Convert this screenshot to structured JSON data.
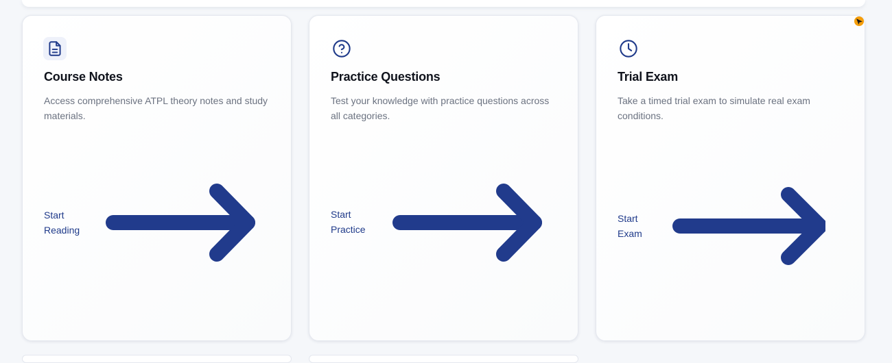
{
  "cards": [
    {
      "title": "Course Notes",
      "description": "Access comprehensive ATPL theory notes and study materials.",
      "action_line1": "Start",
      "action_line2": "Reading",
      "icon": "document-icon"
    },
    {
      "title": "Practice Questions",
      "description": "Test your knowledge with practice questions across all categories.",
      "action_line1": "Start",
      "action_line2": "Practice",
      "icon": "question-circle-icon"
    },
    {
      "title": "Trial Exam",
      "description": "Take a timed trial exam to simulate real exam conditions.",
      "action_line1": "Start",
      "action_line2": "Exam",
      "icon": "clock-icon"
    }
  ],
  "colors": {
    "accent": "#1f3a8a",
    "arrow": "#213b8c",
    "badge": "#f59e0b"
  }
}
